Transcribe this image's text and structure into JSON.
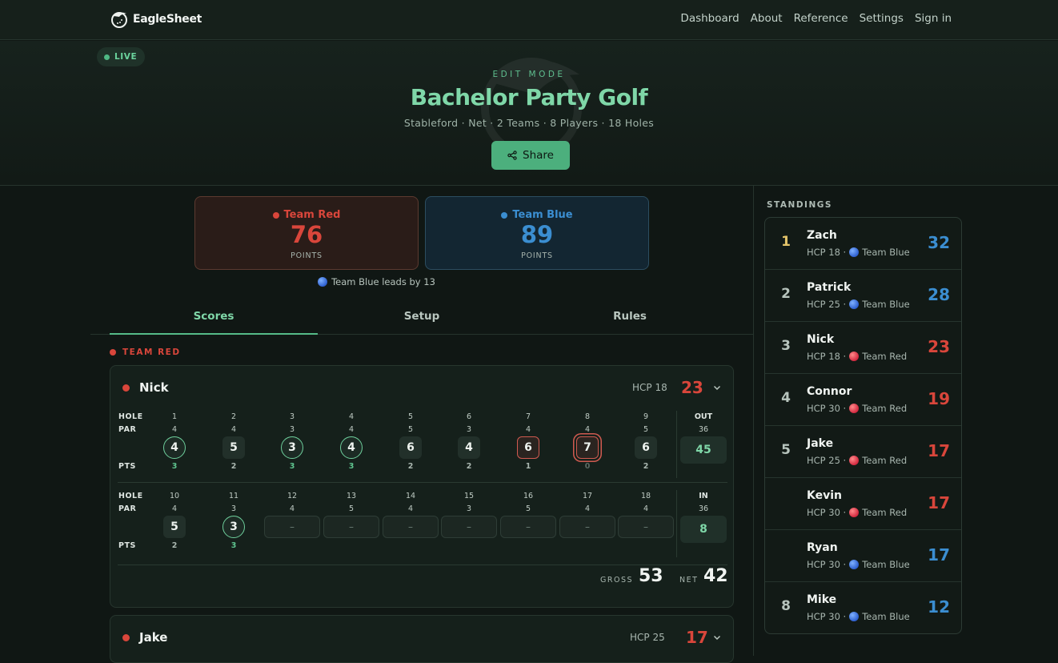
{
  "nav": {
    "brand": "EagleSheet",
    "links": [
      "Dashboard",
      "About",
      "Reference",
      "Settings",
      "Sign in"
    ]
  },
  "hero": {
    "live": "LIVE",
    "mode": "EDIT MODE",
    "title": "Bachelor Party Golf",
    "subtitle": "Stableford · Net · 2 Teams · 8 Players · 18 Holes",
    "share": "Share"
  },
  "teams": {
    "red": {
      "name": "Team Red",
      "points": "76",
      "label": "POINTS",
      "color": "#d9463b"
    },
    "blue": {
      "name": "Team Blue",
      "points": "89",
      "label": "POINTS",
      "color": "#3b8ed1"
    },
    "lead": "Team Blue leads by 13"
  },
  "tabs": [
    "Scores",
    "Setup",
    "Rules"
  ],
  "section": {
    "team_label": "TEAM RED"
  },
  "player": {
    "name": "Nick",
    "hcp": "HCP 18",
    "score": "23",
    "labels": {
      "hole": "HOLE",
      "par": "PAR",
      "pts": "PTS",
      "out": "OUT",
      "in": "IN",
      "gross": "GROSS",
      "net": "NET"
    },
    "front": [
      {
        "hole": "1",
        "par": "4",
        "score": "4",
        "pts": "3",
        "type": "birdie"
      },
      {
        "hole": "2",
        "par": "4",
        "score": "5",
        "pts": "2",
        "type": "plain"
      },
      {
        "hole": "3",
        "par": "3",
        "score": "3",
        "pts": "3",
        "type": "birdie"
      },
      {
        "hole": "4",
        "par": "4",
        "score": "4",
        "pts": "3",
        "type": "birdie"
      },
      {
        "hole": "5",
        "par": "5",
        "score": "6",
        "pts": "2",
        "type": "plain"
      },
      {
        "hole": "6",
        "par": "3",
        "score": "4",
        "pts": "2",
        "type": "plain"
      },
      {
        "hole": "7",
        "par": "4",
        "score": "6",
        "pts": "1",
        "type": "bogey"
      },
      {
        "hole": "8",
        "par": "4",
        "score": "7",
        "pts": "0",
        "type": "dbl"
      },
      {
        "hole": "9",
        "par": "5",
        "score": "6",
        "pts": "2",
        "type": "plain"
      }
    ],
    "back": [
      {
        "hole": "10",
        "par": "4",
        "score": "5",
        "pts": "2",
        "type": "plain"
      },
      {
        "hole": "11",
        "par": "3",
        "score": "3",
        "pts": "3",
        "type": "birdie"
      },
      {
        "hole": "12",
        "par": "4",
        "score": "–",
        "pts": "",
        "type": "empty"
      },
      {
        "hole": "13",
        "par": "5",
        "score": "–",
        "pts": "",
        "type": "empty"
      },
      {
        "hole": "14",
        "par": "4",
        "score": "–",
        "pts": "",
        "type": "empty"
      },
      {
        "hole": "15",
        "par": "3",
        "score": "–",
        "pts": "",
        "type": "empty"
      },
      {
        "hole": "16",
        "par": "5",
        "score": "–",
        "pts": "",
        "type": "empty"
      },
      {
        "hole": "17",
        "par": "4",
        "score": "–",
        "pts": "",
        "type": "empty"
      },
      {
        "hole": "18",
        "par": "4",
        "score": "–",
        "pts": "",
        "type": "empty"
      }
    ],
    "out_par": "36",
    "out_pts": "45",
    "in_par": "36",
    "in_pts": "8",
    "gross": "53",
    "net": "42"
  },
  "player2": {
    "name": "Jake",
    "hcp": "HCP 25",
    "score": "17"
  },
  "standings": {
    "title": "STANDINGS",
    "rows": [
      {
        "rank": "1",
        "name": "Zach",
        "hcp": "HCP 18 ·",
        "team": "Team Blue",
        "team_key": "blue",
        "pts": "32"
      },
      {
        "rank": "2",
        "name": "Patrick",
        "hcp": "HCP 25 ·",
        "team": "Team Blue",
        "team_key": "blue",
        "pts": "28"
      },
      {
        "rank": "3",
        "name": "Nick",
        "hcp": "HCP 18 ·",
        "team": "Team Red",
        "team_key": "red",
        "pts": "23"
      },
      {
        "rank": "4",
        "name": "Connor",
        "hcp": "HCP 30 ·",
        "team": "Team Red",
        "team_key": "red",
        "pts": "19"
      },
      {
        "rank": "5",
        "name": "Jake",
        "hcp": "HCP 25 ·",
        "team": "Team Red",
        "team_key": "red",
        "pts": "17"
      },
      {
        "rank": "",
        "name": "Kevin",
        "hcp": "HCP 30 ·",
        "team": "Team Red",
        "team_key": "red",
        "pts": "17"
      },
      {
        "rank": "",
        "name": "Ryan",
        "hcp": "HCP 30 ·",
        "team": "Team Blue",
        "team_key": "blue",
        "pts": "17"
      },
      {
        "rank": "8",
        "name": "Mike",
        "hcp": "HCP 30 ·",
        "team": "Team Blue",
        "team_key": "blue",
        "pts": "12"
      }
    ]
  }
}
